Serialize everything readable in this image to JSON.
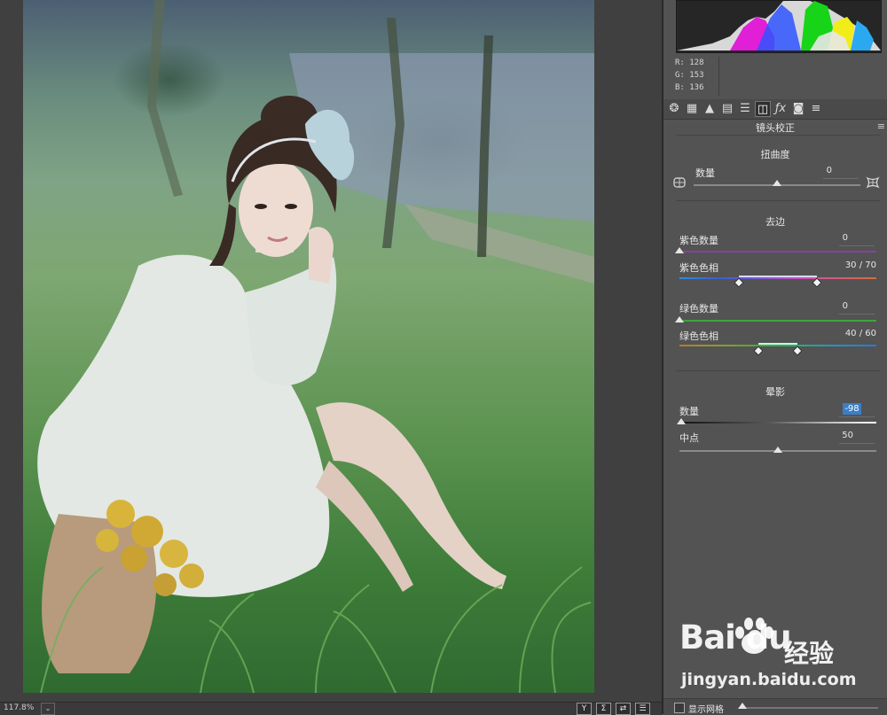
{
  "canvas": {
    "zoom": "117.8%",
    "zoom_dropdown_glyph": "⌄",
    "view_buttons": [
      "Y",
      "Σ",
      "⇄",
      "☰"
    ]
  },
  "histogram": {
    "readout": {
      "r": "R:  128",
      "g": "G:  153",
      "b": "B:  136"
    }
  },
  "tabs": {
    "icons": [
      "aperture-icon",
      "curve-grid-icon",
      "mountain-icon",
      "split-panel-icon",
      "hsl-bars-icon",
      "lens-icon",
      "fx-icon",
      "camera-icon",
      "sliders-icon"
    ],
    "glyphs": [
      "❂",
      "▦",
      "▲",
      "▤",
      "☰",
      "◫",
      "ƒx",
      "◙",
      "≡"
    ],
    "active_index": 5
  },
  "panel": {
    "title": "镜头校正",
    "menu_glyph": "≡"
  },
  "distortion": {
    "title": "扭曲度",
    "amount_label": "数量",
    "amount_value": "0",
    "slider_pos": 0.5
  },
  "defringe": {
    "title": "去边",
    "purple_amount": {
      "label": "紫色数量",
      "value": "0",
      "pos": 0.0
    },
    "purple_hue": {
      "label": "紫色色相",
      "value": "30 / 70",
      "low": 0.3,
      "high": 0.7
    },
    "green_amount": {
      "label": "绿色数量",
      "value": "0",
      "pos": 0.0
    },
    "green_hue": {
      "label": "绿色色相",
      "value": "40 / 60",
      "low": 0.4,
      "high": 0.6
    }
  },
  "vignetting": {
    "title": "晕影",
    "amount": {
      "label": "数量",
      "value": "-98",
      "pos": 0.01
    },
    "midpoint": {
      "label": "中点",
      "value": "50",
      "pos": 0.5
    }
  },
  "footer": {
    "show_grid_label": "显示网格"
  },
  "watermark": {
    "brand": "Bai  du",
    "cn": "经验",
    "url": "jingyan.baidu.com"
  },
  "colors": {
    "accent_blue": "#3b7ec6",
    "purple_track": "#8a3ea8",
    "green_track": "#3fa43c"
  }
}
